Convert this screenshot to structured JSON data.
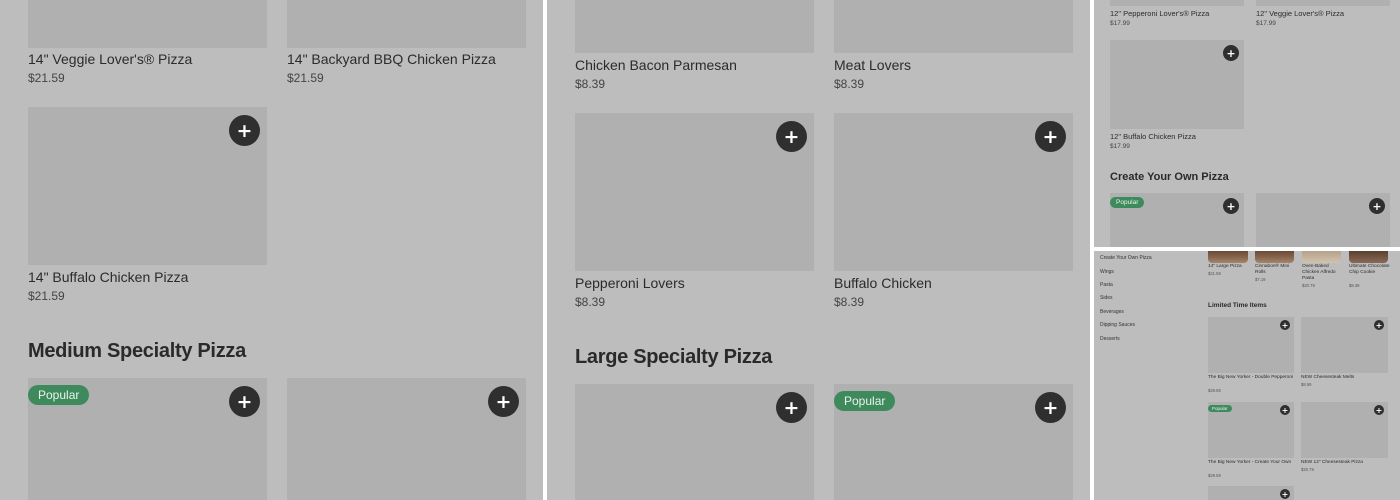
{
  "panel1": {
    "items_top": [
      {
        "name": "14\" Veggie Lover's® Pizza",
        "price": "$21.59"
      },
      {
        "name": "14\" Backyard BBQ Chicken Pizza",
        "price": "$21.59"
      },
      {
        "name": "14\" Buffalo Chicken Pizza",
        "price": "$21.59"
      }
    ],
    "section_title": "Medium Specialty Pizza",
    "popular_badge": "Popular"
  },
  "panel2": {
    "items_top": [
      {
        "name": "Chicken Bacon Parmesan",
        "price": "$8.39"
      },
      {
        "name": "Meat Lovers",
        "price": "$8.39"
      },
      {
        "name": "Pepperoni Lovers",
        "price": "$8.39"
      },
      {
        "name": "Buffalo Chicken",
        "price": "$8.39"
      }
    ],
    "section_title": "Large Specialty Pizza",
    "popular_badge": "Popular"
  },
  "panel3": {
    "items": [
      {
        "name": "12\" Pepperoni Lover's® Pizza",
        "price": "$17.99"
      },
      {
        "name": "12\" Veggie Lover's® Pizza",
        "price": "$17.99"
      },
      {
        "name": "12\" Buffalo Chicken Pizza",
        "price": "$17.99"
      }
    ],
    "section_title": "Create Your Own Pizza",
    "popular_badge": "Popular"
  },
  "panel4": {
    "nav_items": [
      "Create Your Own Pizza",
      "Wings",
      "Pasta",
      "Sides",
      "Beverages",
      "Dipping Sauces",
      "Desserts"
    ],
    "featured": [
      {
        "name": "14\" Large Pizza",
        "price": "$21.59"
      },
      {
        "name": "Cinnabon® Mini Rolls",
        "price": "$7.19"
      },
      {
        "name": "Oven-Baked Chicken Alfredo Pasta",
        "price": "$20.79"
      },
      {
        "name": "Ultimate Chocolate Chip Cookie",
        "price": "$8.39"
      }
    ],
    "section_title": "Limited Time Items",
    "items": [
      {
        "name": "The Big New Yorker - Double Pepperoni",
        "price": "$29.59"
      },
      {
        "name": "NEW Cheesesteak Melts",
        "price": "$8.59"
      },
      {
        "name": "The Big New Yorker - Create Your Own",
        "price": "$29.59"
      },
      {
        "name": "NEW 12\" Cheesesteak Pizza",
        "price": "$20.79"
      }
    ],
    "popular_badge": "Popular"
  },
  "icons": {
    "add": "+"
  }
}
